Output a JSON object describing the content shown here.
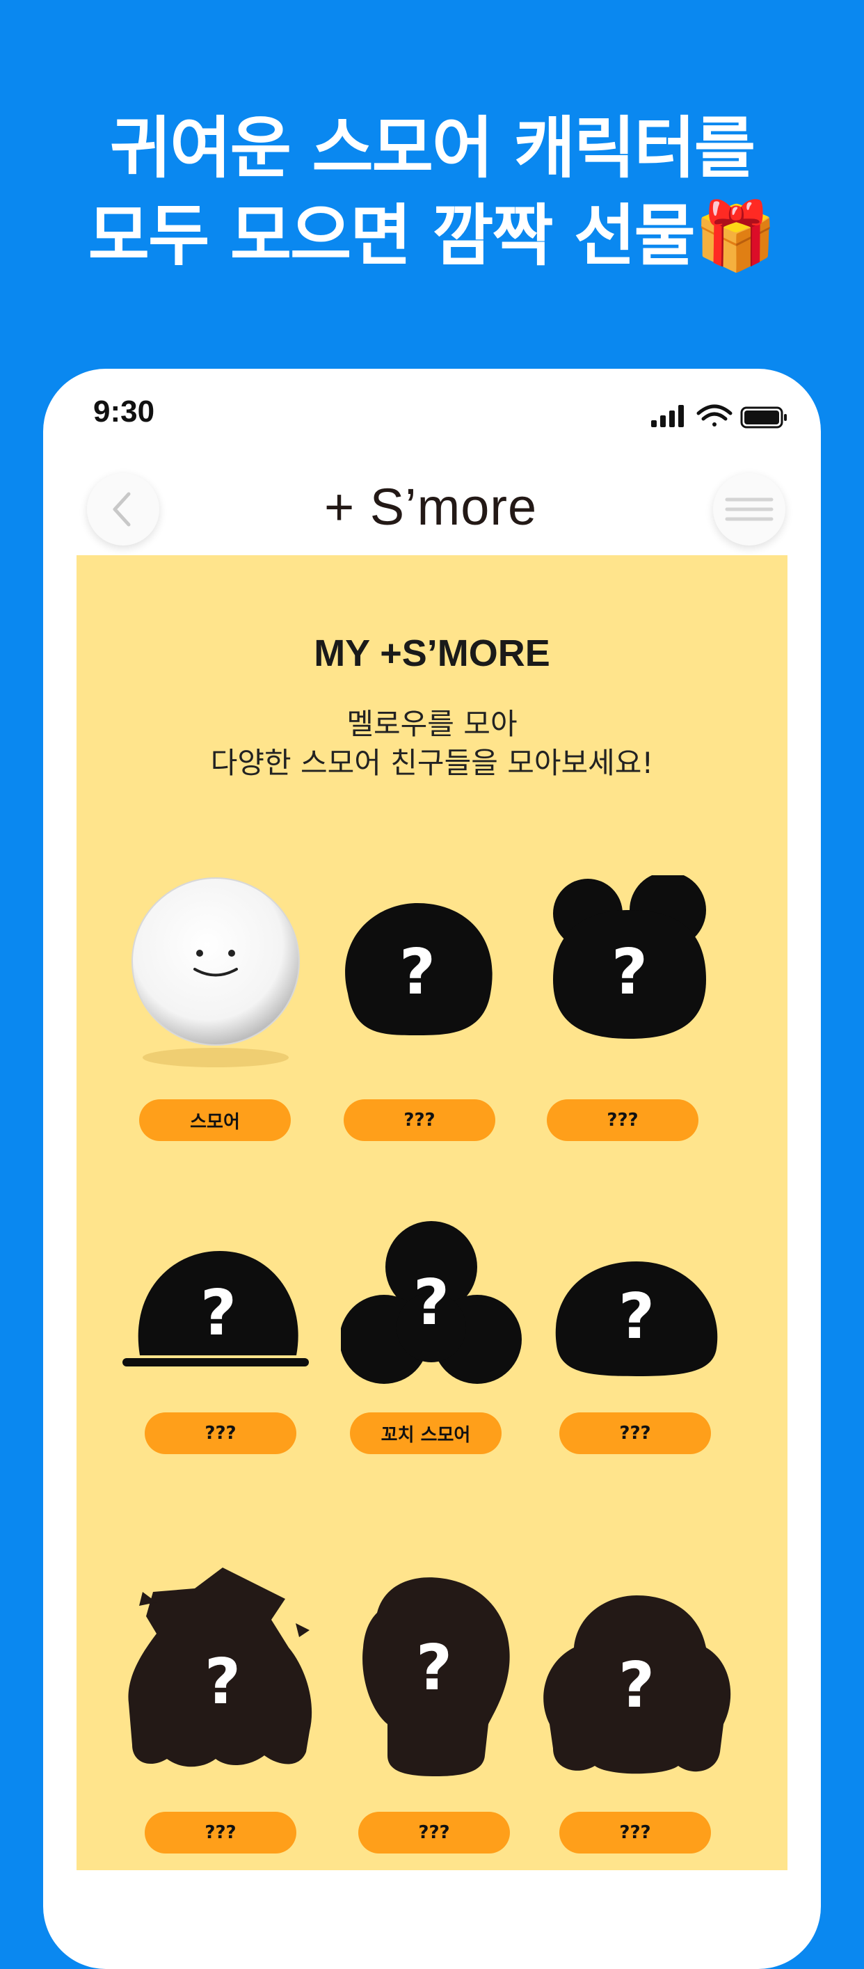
{
  "headline": {
    "line1": "귀여운 스모어 캐릭터를",
    "line2": "모두 모으면 깜짝 선물🎁"
  },
  "status_bar": {
    "time": "9:30"
  },
  "nav": {
    "logo": "+ S’more"
  },
  "collection": {
    "title": "MY +S’MORE",
    "subtitle_line1": "멜로우를 모아",
    "subtitle_line2": "다양한 스모어 친구들을 모아보세요!",
    "items": [
      {
        "label": "스모어",
        "unlocked": true
      },
      {
        "label": "???",
        "unlocked": false
      },
      {
        "label": "???",
        "unlocked": false
      },
      {
        "label": "???",
        "unlocked": false
      },
      {
        "label": "꼬치 스모어",
        "unlocked": false
      },
      {
        "label": "???",
        "unlocked": false
      },
      {
        "label": "???",
        "unlocked": false
      },
      {
        "label": "???",
        "unlocked": false
      },
      {
        "label": "???",
        "unlocked": false
      }
    ]
  },
  "colors": {
    "background": "#0a88f0",
    "panel": "#ffe48c",
    "pill": "#ff9f1a",
    "silhouette": "#0d0d0d"
  }
}
